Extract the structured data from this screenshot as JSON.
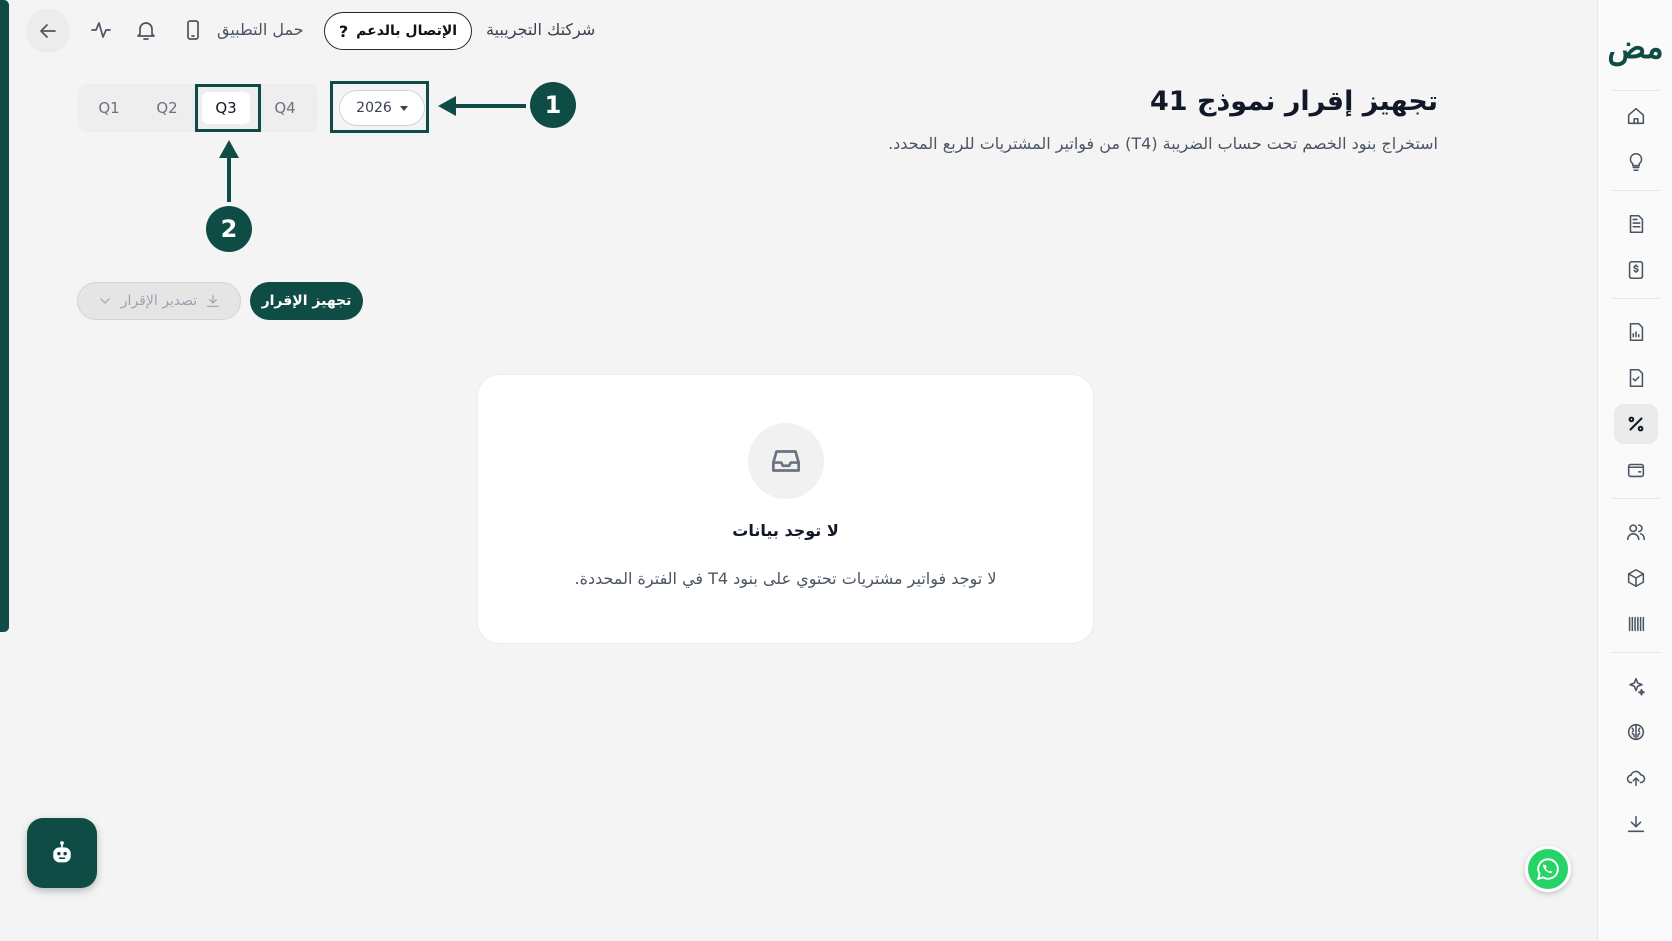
{
  "topbar": {
    "company": "شركتك التجريبية",
    "support_label": "الإتصال بالدعم",
    "support_icon": "?",
    "download_app": "حمل التطبيق"
  },
  "heading": {
    "title": "تجهيز إقرار نموذج 41",
    "description": "استخراج بنود الخصم تحت حساب الضريبة (T4) من فواتير المشتريات للربع المحدد."
  },
  "filters": {
    "year": "2026",
    "quarters": [
      "Q1",
      "Q2",
      "Q3",
      "Q4"
    ],
    "selected_quarter": "Q3"
  },
  "callouts": [
    "1",
    "2"
  ],
  "actions": {
    "prepare": "تجهيز الإقرار",
    "export": "تصدير الإقرار"
  },
  "empty_state": {
    "title": "لا توجد بيانات",
    "message": "لا توجد فواتير مشتريات تحتوي على بنود T4 في الفترة المحددة."
  },
  "brand": {
    "accent": "#0f4c45",
    "logo_text": "مض"
  },
  "sidebar_icons": [
    "home-icon",
    "lightbulb-icon",
    "document-icon",
    "invoice-dollar-icon",
    "report-chart-icon",
    "document-check-icon",
    "percent-icon",
    "wallet-icon",
    "users-icon",
    "package-icon",
    "barcode-icon",
    "sparkles-icon",
    "brain-icon",
    "upload-cloud-icon",
    "download-icon"
  ]
}
